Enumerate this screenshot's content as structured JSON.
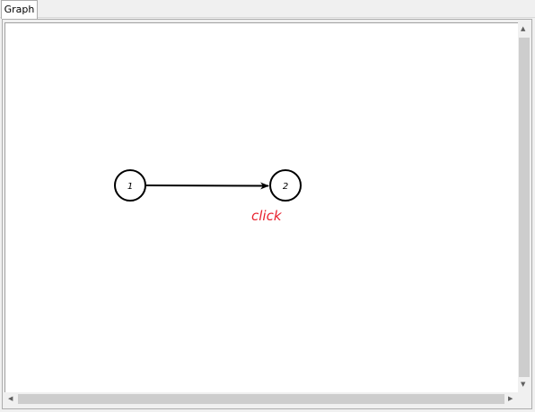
{
  "tab": {
    "label": "Graph"
  },
  "graph": {
    "nodes": [
      {
        "id": "1",
        "label": "1"
      },
      {
        "id": "2",
        "label": "2"
      }
    ],
    "edges": [
      {
        "from": "1",
        "to": "2"
      }
    ],
    "annotation": {
      "text": "click",
      "color": "#e8212d"
    }
  },
  "icons": {
    "scroll_up": "triangle-up",
    "scroll_down": "triangle-down",
    "scroll_left": "triangle-left",
    "scroll_right": "triangle-right"
  }
}
